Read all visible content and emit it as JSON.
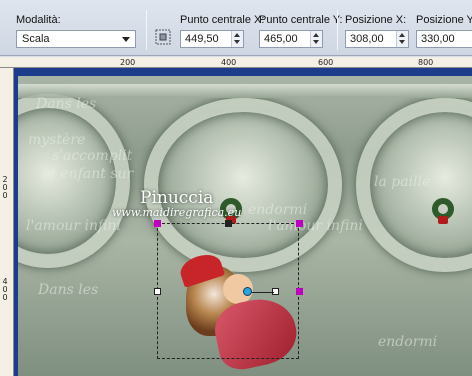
{
  "toolbar": {
    "mode_label": "Modalità:",
    "mode_value": "Scala",
    "center_x_label": "Punto centrale X:",
    "center_x_value": "449,50",
    "center_y_label": "Punto centrale Y:",
    "center_y_value": "465,00",
    "position_x_label": "Posizione X:",
    "position_x_value": "308,00",
    "position_y_label": "Posizione Y:",
    "position_y_value": "330,00"
  },
  "rulers": {
    "top_ticks": [
      "200",
      "400",
      "600",
      "800"
    ],
    "left_ticks": [
      "2\n0\n0",
      "4\n0\n0"
    ]
  },
  "canvas": {
    "watermark_title": "Pinuccia",
    "watermark_url": "www.maidiregrafica.eu",
    "background_text_lines": [
      "Dans les",
      "mystère",
      "s'accomplit",
      "et enfant sur",
      "endormi",
      "l'amour infini",
      "Dans les",
      "la paille",
      "endormi",
      "l'amour infini"
    ]
  },
  "icons": [
    "chevron-down-icon",
    "center-point-icon",
    "spin-up-icon",
    "spin-down-icon",
    "pivot-handle-icon"
  ],
  "colors": {
    "toolbar_bg": "#d6dde8",
    "workspace_bg": "#1e3c8c",
    "handle_magenta": "#c000c0",
    "pivot_blue": "#29a5e0"
  }
}
